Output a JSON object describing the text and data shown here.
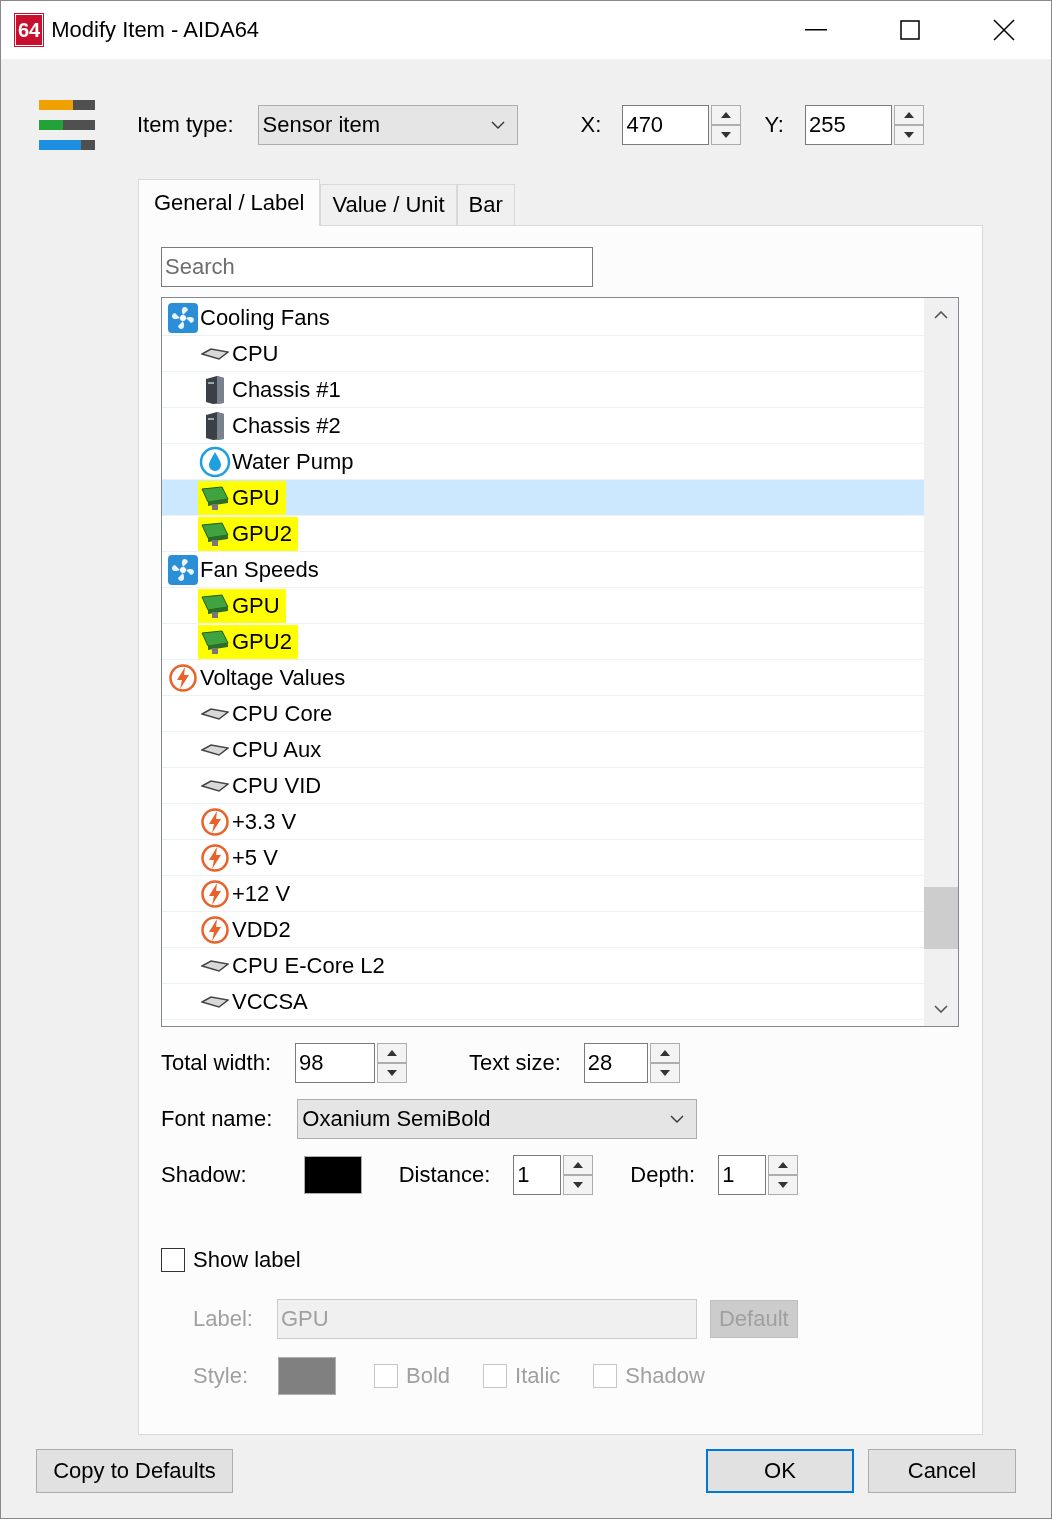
{
  "window": {
    "title": "Modify Item - AIDA64",
    "app_badge": "64"
  },
  "item_type": {
    "label": "Item type:",
    "value": "Sensor item"
  },
  "x": {
    "label": "X:",
    "value": "470"
  },
  "y": {
    "label": "Y:",
    "value": "255"
  },
  "tabs": [
    {
      "label": "General / Label",
      "selected": true
    },
    {
      "label": "Value / Unit",
      "selected": false
    },
    {
      "label": "Bar",
      "selected": false
    }
  ],
  "search": {
    "placeholder": "Search"
  },
  "tree": [
    {
      "label": "Cooling Fans",
      "kind": "fan",
      "selected": false,
      "highlighted": false,
      "children": [
        {
          "label": "CPU",
          "kind": "chip",
          "selected": false,
          "highlighted": false
        },
        {
          "label": "Chassis #1",
          "kind": "chassis",
          "selected": false,
          "highlighted": false
        },
        {
          "label": "Chassis #2",
          "kind": "chassis",
          "selected": false,
          "highlighted": false
        },
        {
          "label": "Water Pump",
          "kind": "pump",
          "selected": false,
          "highlighted": false
        },
        {
          "label": "GPU",
          "kind": "gpu",
          "selected": true,
          "highlighted": true
        },
        {
          "label": "GPU2",
          "kind": "gpu",
          "selected": false,
          "highlighted": true
        }
      ]
    },
    {
      "label": "Fan Speeds",
      "kind": "fan",
      "selected": false,
      "highlighted": false,
      "children": [
        {
          "label": "GPU",
          "kind": "gpu",
          "selected": false,
          "highlighted": true
        },
        {
          "label": "GPU2",
          "kind": "gpu",
          "selected": false,
          "highlighted": true
        }
      ]
    },
    {
      "label": "Voltage Values",
      "kind": "bolt",
      "selected": false,
      "highlighted": false,
      "children": [
        {
          "label": "CPU Core",
          "kind": "chip",
          "selected": false,
          "highlighted": false
        },
        {
          "label": "CPU Aux",
          "kind": "chip",
          "selected": false,
          "highlighted": false
        },
        {
          "label": "CPU VID",
          "kind": "chip",
          "selected": false,
          "highlighted": false
        },
        {
          "label": "+3.3 V",
          "kind": "bolt",
          "selected": false,
          "highlighted": false
        },
        {
          "label": "+5 V",
          "kind": "bolt",
          "selected": false,
          "highlighted": false
        },
        {
          "label": "+12 V",
          "kind": "bolt",
          "selected": false,
          "highlighted": false
        },
        {
          "label": "VDD2",
          "kind": "bolt",
          "selected": false,
          "highlighted": false
        },
        {
          "label": "CPU E-Core L2",
          "kind": "chip",
          "selected": false,
          "highlighted": false
        },
        {
          "label": "VCCSA",
          "kind": "chip",
          "selected": false,
          "highlighted": false
        }
      ]
    }
  ],
  "total_width": {
    "label": "Total width:",
    "value": "98"
  },
  "text_size": {
    "label": "Text size:",
    "value": "28"
  },
  "font_name": {
    "label": "Font name:",
    "value": "Oxanium SemiBold"
  },
  "shadow": {
    "label": "Shadow:",
    "color": "#000000"
  },
  "distance": {
    "label": "Distance:",
    "value": "1"
  },
  "depth": {
    "label": "Depth:",
    "value": "1"
  },
  "show_label": {
    "label": "Show label",
    "checked": false
  },
  "label_field": {
    "label": "Label:",
    "value": "GPU",
    "disabled": true
  },
  "default_button": {
    "label": "Default",
    "disabled": true
  },
  "style": {
    "label": "Style:",
    "color": "#808080",
    "disabled": true
  },
  "style_options": [
    {
      "label": "Bold",
      "checked": false,
      "disabled": true
    },
    {
      "label": "Italic",
      "checked": false,
      "disabled": true
    },
    {
      "label": "Shadow",
      "checked": false,
      "disabled": true
    }
  ],
  "buttons": [
    {
      "label": "Copy to Defaults",
      "kind": "secondary"
    },
    {
      "label": "OK",
      "kind": "default"
    },
    {
      "label": "Cancel",
      "kind": "secondary"
    }
  ]
}
